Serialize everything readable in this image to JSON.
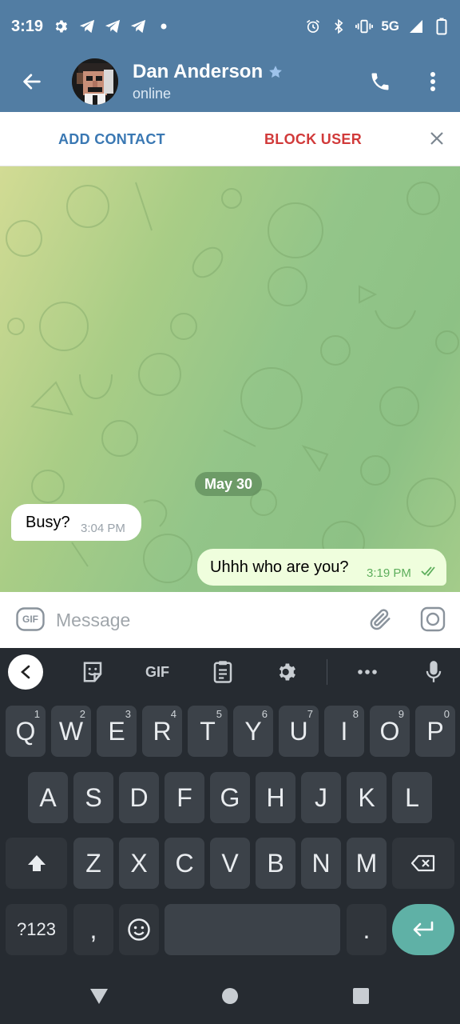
{
  "status_bar": {
    "time": "3:19",
    "network": "5G",
    "left_icons": [
      "settings-icon",
      "telegram-icon",
      "telegram-icon",
      "telegram-icon",
      "dot-icon"
    ],
    "right_icons": [
      "alarm-icon",
      "bluetooth-icon",
      "vibrate-icon",
      "signal-icon",
      "battery-icon"
    ]
  },
  "header": {
    "contact_name": "Dan Anderson",
    "contact_status": "online",
    "accent_color": "#527da3"
  },
  "action_bar": {
    "add_contact_label": "ADD CONTACT",
    "block_user_label": "BLOCK USER"
  },
  "chat": {
    "date_chip": "May 30",
    "messages": [
      {
        "direction": "incoming",
        "text": "Busy?",
        "time": "3:04 PM"
      },
      {
        "direction": "outgoing",
        "text": "Uhhh who are you?",
        "time": "3:19 PM",
        "status": "read"
      }
    ]
  },
  "composer": {
    "placeholder": "Message",
    "gif_label": "GIF"
  },
  "keyboard": {
    "toolbar_gif_label": "GIF",
    "row1": [
      {
        "key": "Q",
        "hint": "1"
      },
      {
        "key": "W",
        "hint": "2"
      },
      {
        "key": "E",
        "hint": "3"
      },
      {
        "key": "R",
        "hint": "4"
      },
      {
        "key": "T",
        "hint": "5"
      },
      {
        "key": "Y",
        "hint": "6"
      },
      {
        "key": "U",
        "hint": "7"
      },
      {
        "key": "I",
        "hint": "8"
      },
      {
        "key": "O",
        "hint": "9"
      },
      {
        "key": "P",
        "hint": "0"
      }
    ],
    "row2": [
      "A",
      "S",
      "D",
      "F",
      "G",
      "H",
      "J",
      "K",
      "L"
    ],
    "row3": [
      "Z",
      "X",
      "C",
      "V",
      "B",
      "N",
      "M"
    ],
    "symbols_label": "?123",
    "comma_label": ",",
    "period_label": "."
  }
}
